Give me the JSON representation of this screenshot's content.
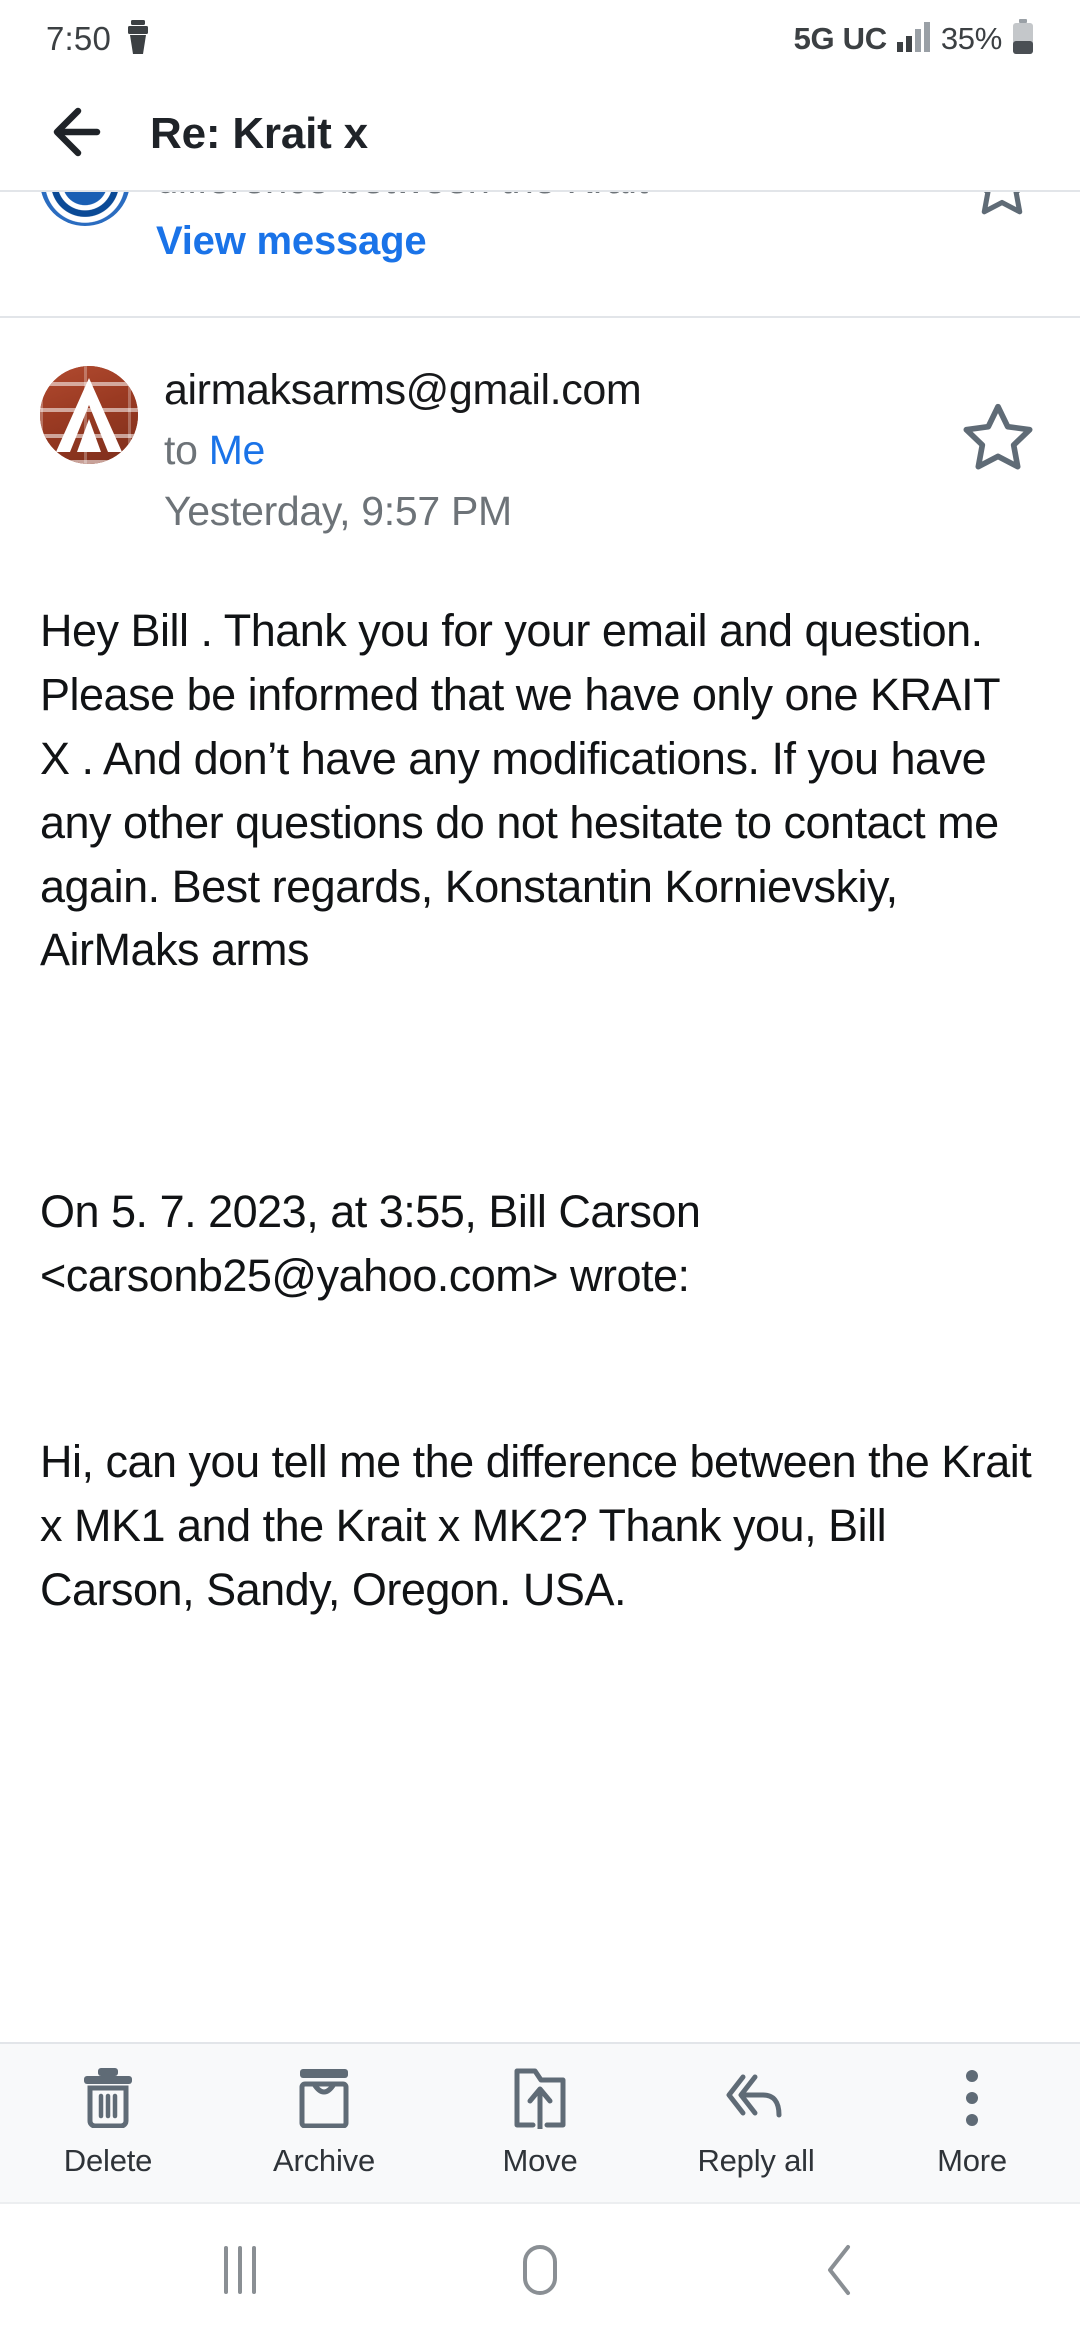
{
  "status_bar": {
    "time": "7:50",
    "brush_icon": "brush-icon",
    "network": "5G UC",
    "signal_icon": "signal-bars-icon",
    "battery_percent": "35%",
    "battery_icon": "battery-icon"
  },
  "app_bar": {
    "back_icon": "back-arrow-icon",
    "title": "Re: Krait x"
  },
  "thread": {
    "collapsed_message": {
      "snippet": "difference between the Krait",
      "view_message_label": "View message",
      "star_icon": "star-outline-icon",
      "avatar": "contact-avatar"
    },
    "open_message": {
      "sender": "airmaksarms@gmail.com",
      "to_prefix": "to",
      "to_recipient": "Me",
      "date": "Yesterday, 9:57 PM",
      "star_icon": "star-outline-icon",
      "avatar_letter": "A",
      "body": "Hey Bill . Thank you for your email and question. Please be informed that we have only one KRAIT X . And don’t have any modifications. If you have any other questions do not hesitate to contact me again. Best regards, Konstantin Kornievskiy, AirMaks arms",
      "quote_header": "On 5. 7. 2023, at 3:55, Bill Carson <carsonb25@yahoo.com> wrote:",
      "quote_body": "Hi, can you tell me the difference between the Krait x MK1 and the Krait x MK2? Thank you,  Bill Carson,  Sandy, Oregon.  USA."
    }
  },
  "toolbar": {
    "items": [
      {
        "label": "Delete",
        "icon": "trash-icon"
      },
      {
        "label": "Archive",
        "icon": "archive-icon"
      },
      {
        "label": "Move",
        "icon": "move-folder-icon"
      },
      {
        "label": "Reply all",
        "icon": "reply-all-icon"
      },
      {
        "label": "More",
        "icon": "more-vertical-icon"
      }
    ]
  },
  "nav_bar": {
    "recents_icon": "recents-icon",
    "home_icon": "home-icon",
    "back_icon": "nav-back-icon"
  },
  "colors": {
    "link": "#1a73e8",
    "text": "#111315",
    "muted": "#6d7378",
    "toolbar_bg": "#f8f9fa",
    "icon_gray": "#5f6b76"
  }
}
